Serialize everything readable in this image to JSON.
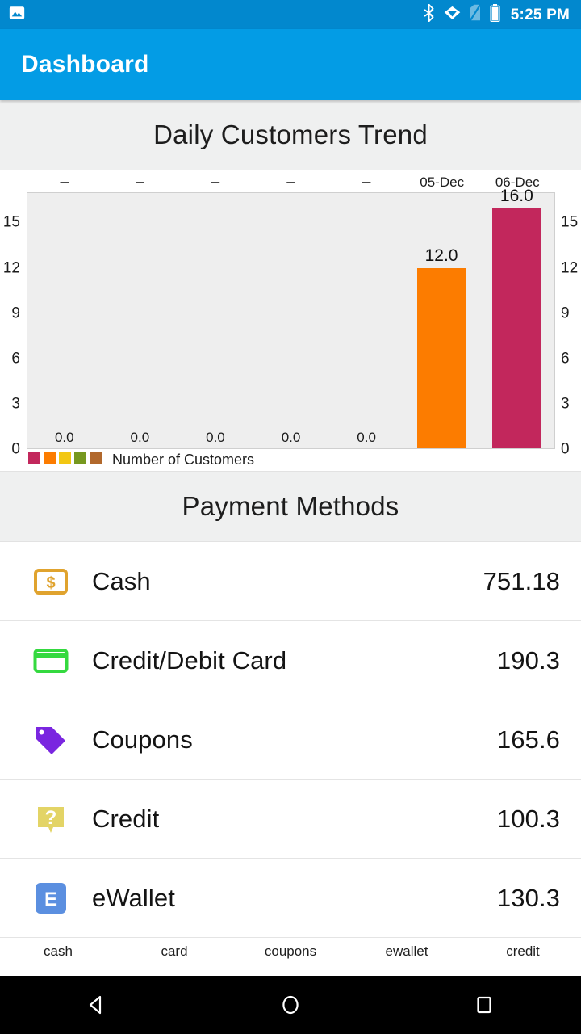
{
  "status_bar": {
    "time": "5:25 PM",
    "left_icons": [
      "screenshot-image-icon"
    ],
    "right_icons": [
      "bluetooth-icon",
      "wifi-icon",
      "no-sim-icon",
      "battery-icon"
    ],
    "background_color": "#0288ce"
  },
  "app_bar": {
    "title": "Dashboard",
    "background_color": "#039ce5",
    "text_color": "#ffffff"
  },
  "chart_card": {
    "title": "Daily Customers Trend"
  },
  "chart_data": {
    "type": "bar",
    "title": "Daily Customers Trend",
    "xlabel": "",
    "ylabel": "",
    "categories": [
      "–",
      "–",
      "–",
      "–",
      "–",
      "05-Dec",
      "06-Dec"
    ],
    "values": [
      0.0,
      0.0,
      0.0,
      0.0,
      0.0,
      12.0,
      16.0
    ],
    "value_labels": [
      "0.0",
      "0.0",
      "0.0",
      "0.0",
      "0.0",
      "12.0",
      "16.0"
    ],
    "bar_colors": [
      "#c2275c",
      "#fc7c00",
      "#f2c713",
      "#76981f",
      "#b1682c",
      "#fc7c00",
      "#c2275c"
    ],
    "ylim": [
      0,
      17
    ],
    "yticks": [
      0,
      3,
      6,
      9,
      12,
      15
    ],
    "ytick_labels": [
      "0",
      "3",
      "6",
      "9",
      "12",
      "15"
    ],
    "left_axis": true,
    "right_axis": true,
    "grid": false,
    "plot_background": "#eeeeee",
    "legend": {
      "position": "bottom-left",
      "label": "Number of Customers",
      "swatch_colors": [
        "#c2275c",
        "#fc7c00",
        "#f2c713",
        "#76981f",
        "#b1682c"
      ]
    }
  },
  "payments_card": {
    "title": "Payment Methods",
    "rows": [
      {
        "icon": "cash-dollar-icon",
        "icon_color": "#e0a32e",
        "label": "Cash",
        "amount": "751.18"
      },
      {
        "icon": "credit-card-icon",
        "icon_color": "#34d93f",
        "label": "Credit/Debit Card",
        "amount": "190.3"
      },
      {
        "icon": "coupon-tag-icon",
        "icon_color": "#7a26e0",
        "label": "Coupons",
        "amount": "165.6"
      },
      {
        "icon": "question-bubble-icon",
        "icon_color": "#e3d466",
        "label": "Credit",
        "amount": "100.3"
      },
      {
        "icon": "ewallet-e-icon",
        "icon_color": "#5b8fe0",
        "label": "eWallet",
        "amount": "130.3"
      }
    ]
  },
  "pie_legend": {
    "items": [
      "cash",
      "card",
      "coupons",
      "ewallet",
      "credit"
    ]
  },
  "nav_bar": {
    "buttons": [
      "back-button",
      "home-button",
      "recents-button"
    ],
    "background_color": "#000000"
  }
}
